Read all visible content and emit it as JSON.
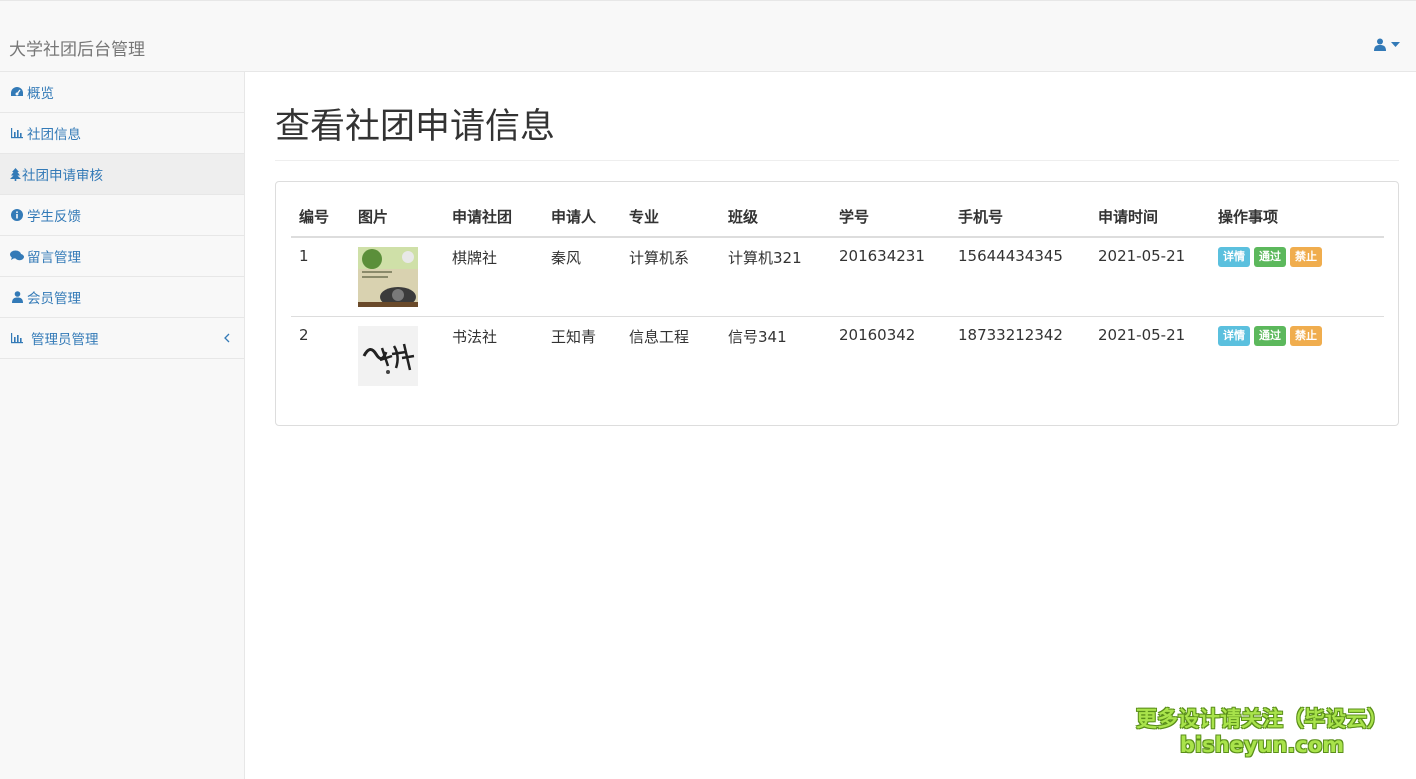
{
  "navbar": {
    "brand": "大学社团后台管理",
    "user_icon": "user-icon"
  },
  "sidebar": {
    "items": [
      {
        "label": "概览",
        "icon": "dashboard-icon"
      },
      {
        "label": "社团信息",
        "icon": "bar-chart-icon"
      },
      {
        "label": "社团申请审核",
        "icon": "tree-icon"
      },
      {
        "label": "学生反馈",
        "icon": "info-circle-icon"
      },
      {
        "label": "留言管理",
        "icon": "comments-icon"
      },
      {
        "label": "会员管理",
        "icon": "user-icon"
      },
      {
        "label": "管理员管理",
        "icon": "bar-chart-icon"
      }
    ]
  },
  "main": {
    "title": "查看社团申请信息",
    "table": {
      "headers": [
        "编号",
        "图片",
        "申请社团",
        "申请人",
        "专业",
        "班级",
        "学号",
        "手机号",
        "申请时间",
        "操作事项"
      ],
      "rows": [
        {
          "id": "1",
          "club": "棋牌社",
          "applicant": "秦风",
          "major": "计算机系",
          "class": "计算机321",
          "student_no": "201634231",
          "phone": "15644434345",
          "date": "2021-05-21"
        },
        {
          "id": "2",
          "club": "书法社",
          "applicant": "王知青",
          "major": "信息工程",
          "class": "信号341",
          "student_no": "20160342",
          "phone": "18733212342",
          "date": "2021-05-21"
        }
      ],
      "actions": {
        "detail": "详情",
        "approve": "通过",
        "ban": "禁止"
      }
    }
  },
  "watermark": {
    "line1": "更多设计请关注（毕设云）",
    "line2": "bisheyun.com"
  },
  "colors": {
    "link": "#337ab7",
    "info": "#5bc0de",
    "success": "#5cb85c",
    "warning": "#f0ad4e"
  }
}
